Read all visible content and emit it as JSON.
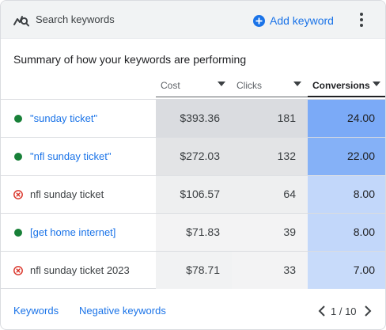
{
  "header": {
    "search_label": "Search keywords",
    "add_label": "Add keyword",
    "accent": "#1a73e8"
  },
  "summary_title": "Summary of how your keywords are performing",
  "columns": {
    "cost": "Cost",
    "clicks": "Clicks",
    "conversions": "Conversions"
  },
  "rows": [
    {
      "keyword": "\"sunday ticket\"",
      "status": "enabled",
      "cost": "$393.36",
      "clicks": "181",
      "conversions": "24.00",
      "cost_bg": "#dadce0",
      "clicks_bg": "#dadce0",
      "conv_bg": "#7baaf7"
    },
    {
      "keyword": "\"nfl sunday ticket\"",
      "status": "enabled",
      "cost": "$272.03",
      "clicks": "132",
      "conversions": "22.00",
      "cost_bg": "#e3e4e6",
      "clicks_bg": "#e3e4e6",
      "conv_bg": "#85b1f7"
    },
    {
      "keyword": "nfl sunday ticket",
      "status": "removed",
      "cost": "$106.57",
      "clicks": "64",
      "conversions": "8.00",
      "cost_bg": "#eeeff0",
      "clicks_bg": "#eeeff0",
      "conv_bg": "#c2d7fa"
    },
    {
      "keyword": "[get home internet]",
      "status": "enabled",
      "cost": "$71.83",
      "clicks": "39",
      "conversions": "8.00",
      "cost_bg": "#f3f3f4",
      "clicks_bg": "#f3f3f4",
      "conv_bg": "#c2d7fa"
    },
    {
      "keyword": "nfl sunday ticket 2023",
      "status": "removed",
      "cost": "$78.71",
      "clicks": "33",
      "conversions": "7.00",
      "cost_bg": "#f1f2f3",
      "clicks_bg": "#f3f3f4",
      "conv_bg": "#c8dbfa"
    }
  ],
  "footer": {
    "tab_keywords": "Keywords",
    "tab_negative": "Negative keywords",
    "pager": "1 / 10"
  },
  "icons": {
    "search": "search-keywords-icon",
    "add": "add-circle-icon",
    "more": "more-vert-icon",
    "enabled": "green-dot-icon",
    "removed": "cancel-circle-icon",
    "prev": "chevron-left-icon",
    "next": "chevron-right-icon"
  }
}
